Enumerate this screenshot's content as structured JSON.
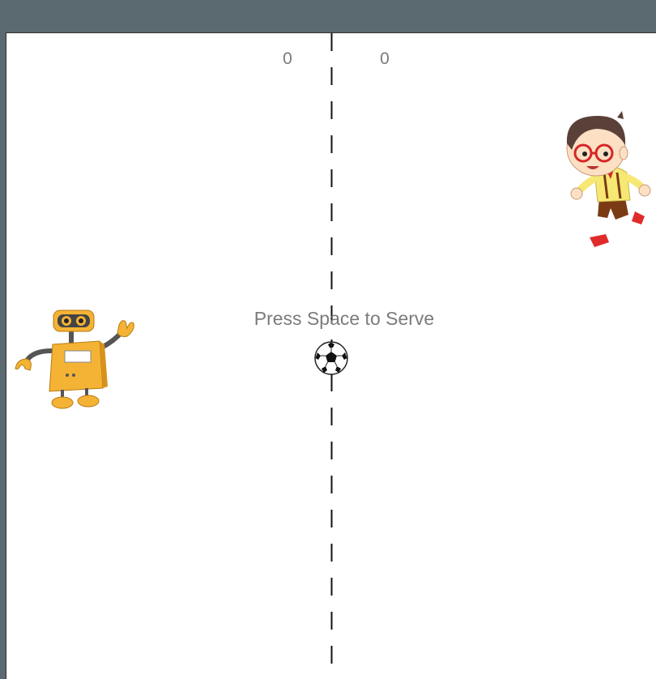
{
  "game": {
    "score_left": "0",
    "score_right": "0",
    "prompt": "Press Space to Serve"
  },
  "sprites": {
    "left_player": "robot-icon",
    "right_player": "running-kid-icon",
    "ball": "soccer-ball-icon"
  },
  "colors": {
    "frame": "#5b6a70",
    "field": "#ffffff",
    "text": "#7b7b7b",
    "robot": "#f5b335"
  }
}
